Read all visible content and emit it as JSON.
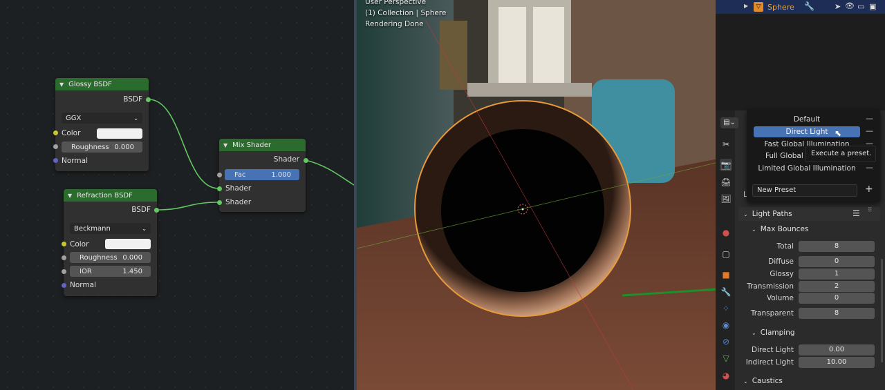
{
  "node_editor": {
    "glossy": {
      "title": "Glossy BSDF",
      "output": "BSDF",
      "distribution": "GGX",
      "color_label": "Color",
      "color_value": "#f1f1f1",
      "roughness_label": "Roughness",
      "roughness_value": "0.000",
      "normal_label": "Normal"
    },
    "refraction": {
      "title": "Refraction BSDF",
      "output": "BSDF",
      "distribution": "Beckmann",
      "color_label": "Color",
      "color_value": "#f1f1f1",
      "roughness_label": "Roughness",
      "roughness_value": "0.000",
      "ior_label": "IOR",
      "ior_value": "1.450",
      "normal_label": "Normal"
    },
    "mix": {
      "title": "Mix Shader",
      "output": "Shader",
      "fac_label": "Fac",
      "fac_value": "1.000",
      "input1": "Shader",
      "input2": "Shader"
    }
  },
  "viewport": {
    "mode": "User Perspective",
    "collection": "(1) Collection | Sphere",
    "status": "Rendering Done"
  },
  "outliner": {
    "object_name": "Sphere"
  },
  "presets": {
    "items": [
      "Default",
      "Direct Light",
      "Fast Global Illumination",
      "Full Global Illumination",
      "Limited Global Illumination"
    ],
    "selected": "Direct Light",
    "new_preset_placeholder": "New Preset",
    "tooltip": "Execute a preset."
  },
  "properties": {
    "partial_label": "L",
    "light_paths": "Light Paths",
    "max_bounces": "Max Bounces",
    "bounces": [
      {
        "label": "Total",
        "value": "8"
      },
      {
        "label": "Diffuse",
        "value": "0"
      },
      {
        "label": "Glossy",
        "value": "1"
      },
      {
        "label": "Transmission",
        "value": "2"
      },
      {
        "label": "Volume",
        "value": "0"
      },
      {
        "label": "Transparent",
        "value": "8"
      }
    ],
    "clamping": "Clamping",
    "clamp": [
      {
        "label": "Direct Light",
        "value": "0.00"
      },
      {
        "label": "Indirect Light",
        "value": "10.00"
      }
    ],
    "caustics": "Caustics"
  },
  "colors": {
    "node_header": "#2b6b2d",
    "selection": "#4772b3",
    "arrow": "#1f8f2a",
    "link": "#63c763"
  }
}
